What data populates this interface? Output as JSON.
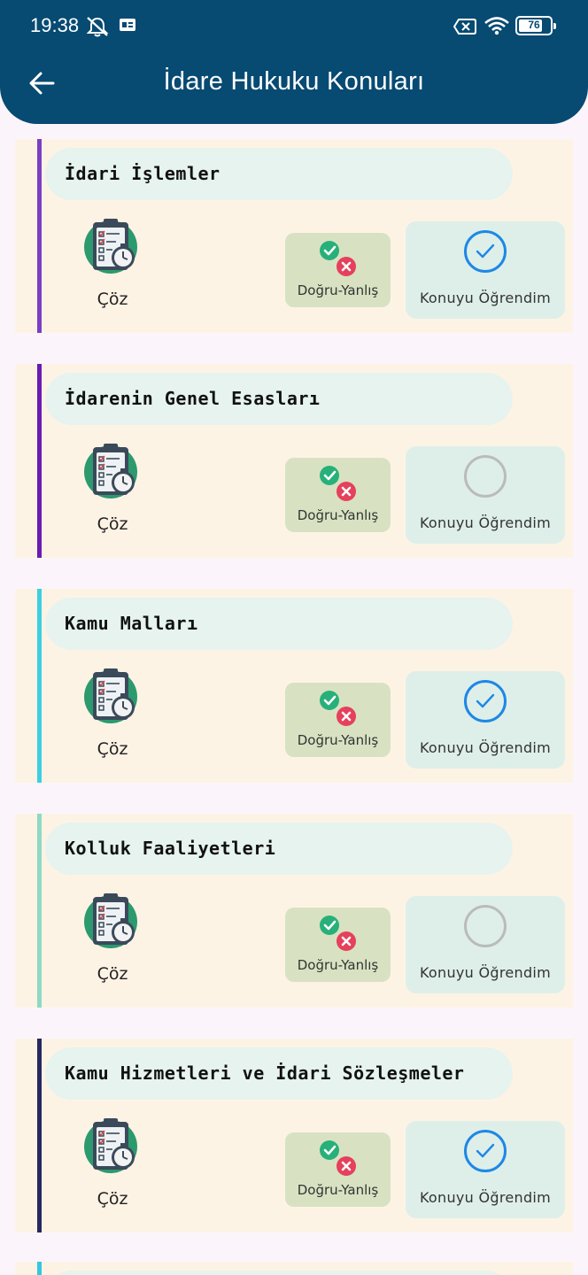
{
  "status_bar": {
    "time": "19:38",
    "battery": "76",
    "battery_level": 76,
    "icons": [
      "vibrate-off-icon",
      "sim-card-icon",
      "no-signal-icon",
      "wifi-icon",
      "battery-icon"
    ]
  },
  "appbar": {
    "title": "İdare Hukuku Konuları",
    "back_icon": "arrow-left-icon",
    "bg_color": "#074a72"
  },
  "labels": {
    "solve": "Çöz",
    "true_false": "Doğru-Yanlış",
    "learned": "Konuyu Öğrendim"
  },
  "topics": [
    {
      "title": "İdari İşlemler",
      "accent": "#7b3fc4",
      "learned": true
    },
    {
      "title": "İdarenin Genel Esasları",
      "accent": "#6a1bb2",
      "learned": false
    },
    {
      "title": "Kamu Malları",
      "accent": "#3dcfe0",
      "learned": true
    },
    {
      "title": "Kolluk Faaliyetleri",
      "accent": "#8fd8c4",
      "learned": false
    },
    {
      "title": "Kamu Hizmetleri ve İdari Sözleşmeler",
      "accent": "#26285e",
      "learned": true
    }
  ],
  "colors": {
    "card_bg": "#fdf3e5",
    "header_pill": "#e6f3ef",
    "true_false_bg": "#d8e2c2",
    "learn_bg": "#deefea",
    "check_blue": "#1e88e5"
  }
}
